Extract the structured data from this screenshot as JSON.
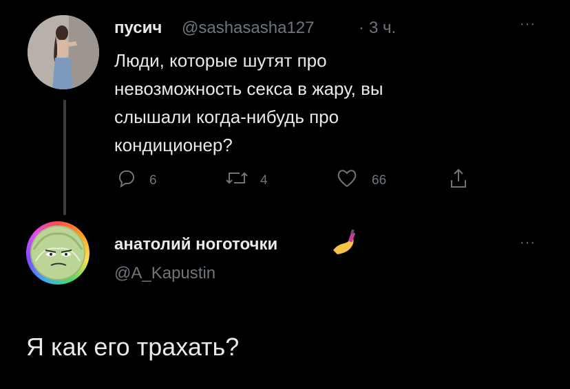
{
  "tweet1": {
    "name": "пусич",
    "handle": "@sashasasha127",
    "separator": "·",
    "time": "3 ч.",
    "more": "···",
    "text": "Люди, которые шутят про\nневозможность секса в жару, вы\nслышали когда-нибудь про\nкондиционер?",
    "replies": "6",
    "retweets": "4",
    "likes": "66"
  },
  "tweet2": {
    "name": "анатолий ноготочки",
    "handle": "@A_Kapustin",
    "more": "···",
    "text": "Я как его трахать?"
  },
  "icons": {
    "reply": "reply-icon",
    "retweet": "retweet-icon",
    "like": "heart-icon",
    "share": "share-icon",
    "nail": "nail-polish-emoji"
  },
  "colors": {
    "background": "#000000",
    "primary_text": "#e7e9ea",
    "secondary_text": "#6e767d"
  }
}
